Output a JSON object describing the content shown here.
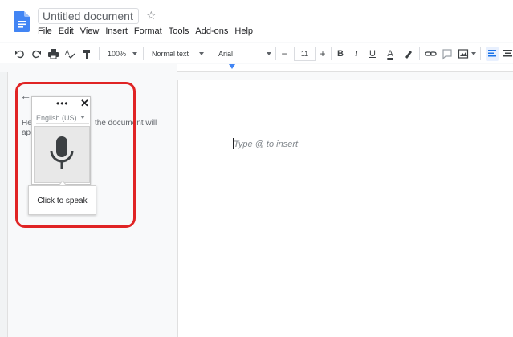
{
  "titlebar": {
    "doc_title": "Untitled document"
  },
  "menu": [
    "File",
    "Edit",
    "View",
    "Insert",
    "Format",
    "Tools",
    "Add-ons",
    "Help"
  ],
  "toolbar": {
    "zoom": "100%",
    "style": "Normal text",
    "font": "Arial",
    "font_size": "11",
    "minus": "−",
    "plus": "+",
    "bold": "B",
    "italic": "I",
    "underline": "U",
    "text_color": "A"
  },
  "document": {
    "placeholder": "Type @ to insert"
  },
  "outline": {
    "line1_left": "He",
    "line1_right": "the document will",
    "line2": "app"
  },
  "voice_typing": {
    "dots": "•••",
    "close": "✕",
    "language": "English (US)",
    "tooltip": "Click to speak"
  },
  "colors": {
    "accent": "#4285f4",
    "highlight": "#e02424",
    "mic": "#3c4043"
  }
}
